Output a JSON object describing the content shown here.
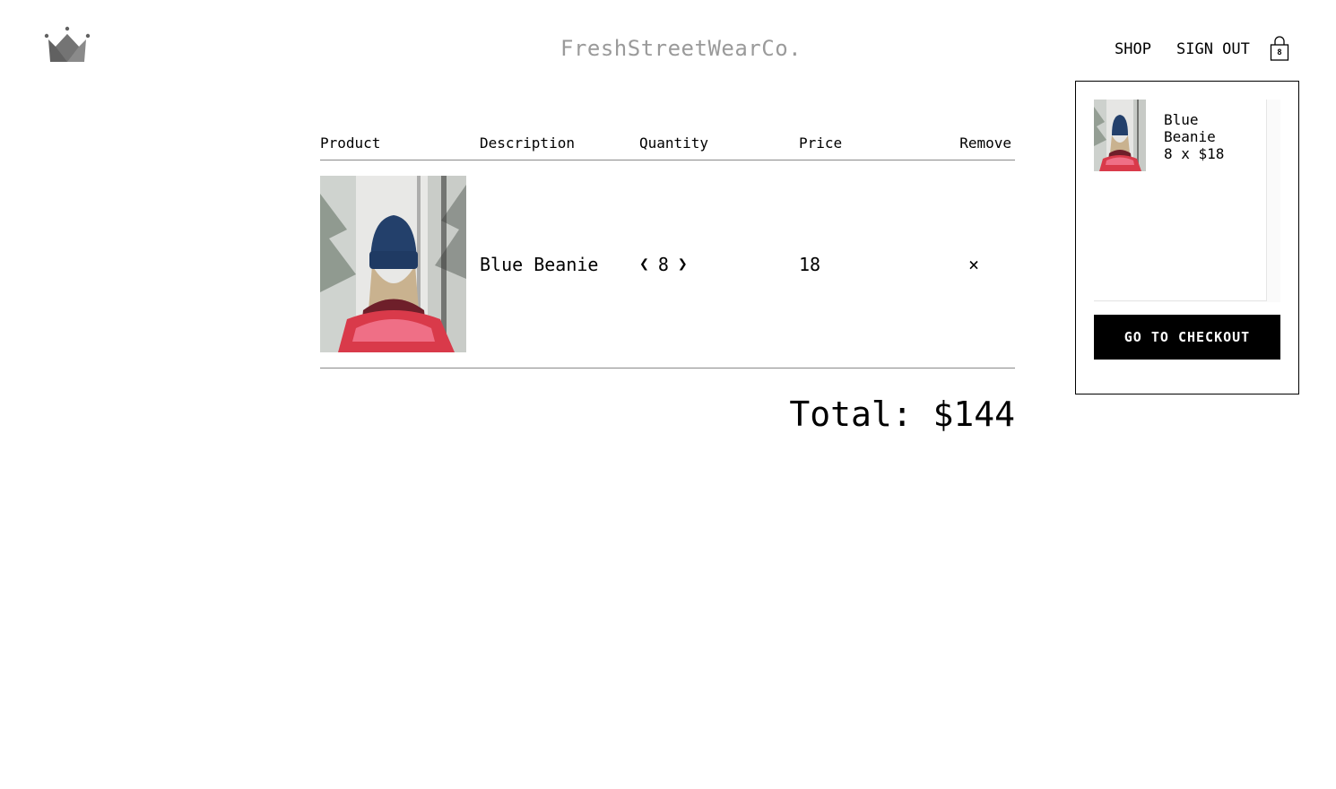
{
  "header": {
    "logo_icon": "crown-icon",
    "brand": "FreshStreetWearCo.",
    "nav": {
      "shop": "SHOP",
      "sign_out": "SIGN OUT"
    },
    "bag": {
      "icon": "shopping-bag-icon",
      "count": "8"
    }
  },
  "checkout": {
    "columns": [
      "Product",
      "Description",
      "Quantity",
      "Price",
      "Remove"
    ],
    "items": [
      {
        "image": "blue-beanie-photo",
        "name": "Blue Beanie",
        "quantity": "8",
        "price": "18",
        "remove": "×",
        "dec": "❮",
        "inc": "❯"
      }
    ],
    "total": "Total: $144"
  },
  "cart_dropdown": {
    "items": [
      {
        "name": "Blue Beanie",
        "summary": "8 x $18"
      }
    ],
    "checkout_button": "GO TO CHECKOUT"
  },
  "colors": {
    "brand_gray": "#9a9a9a",
    "crown_dark": "#616161",
    "crown_light": "#8a8a8a",
    "button_bg": "#000000"
  }
}
